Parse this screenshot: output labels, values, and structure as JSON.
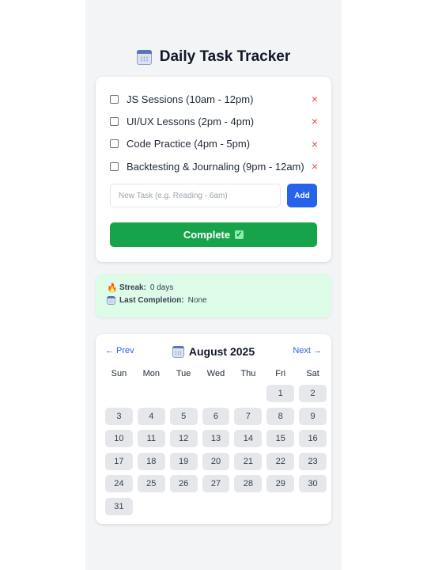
{
  "app": {
    "title": "Daily Task Tracker",
    "title_icon": "calendar-icon"
  },
  "tasks": [
    {
      "label": "JS Sessions (10am - 12pm)",
      "checked": false
    },
    {
      "label": "UI/UX Lessons (2pm - 4pm)",
      "checked": false
    },
    {
      "label": "Code Practice (4pm - 5pm)",
      "checked": false
    },
    {
      "label": "Backtesting & Journaling (9pm - 12am)",
      "checked": false
    }
  ],
  "delete_symbol": "×",
  "new_task": {
    "placeholder": "New Task (e.g. Reading - 6am)",
    "value": "",
    "add_label": "Add"
  },
  "complete": {
    "label": "Complete",
    "icon": "check-box-icon"
  },
  "streak": {
    "label": "Streak:",
    "value": "0 days",
    "icon": "fire-icon"
  },
  "last_completion": {
    "label": "Last Completion:",
    "value": "None",
    "icon": "calendar-icon"
  },
  "calendar": {
    "prev_label": "← Prev",
    "next_label": "Next →",
    "month_label": "August 2025",
    "weekdays": [
      "Sun",
      "Mon",
      "Tue",
      "Wed",
      "Thu",
      "Fri",
      "Sat"
    ],
    "leading_blanks": 5,
    "days": [
      "1",
      "2",
      "3",
      "4",
      "5",
      "6",
      "7",
      "8",
      "9",
      "10",
      "11",
      "12",
      "13",
      "14",
      "15",
      "16",
      "17",
      "18",
      "19",
      "20",
      "21",
      "22",
      "23",
      "24",
      "25",
      "26",
      "27",
      "28",
      "29",
      "30",
      "31"
    ]
  },
  "colors": {
    "primary": "#2563eb",
    "success": "#16a34a",
    "danger": "#ef4444",
    "streak_bg": "#dcfce7"
  }
}
